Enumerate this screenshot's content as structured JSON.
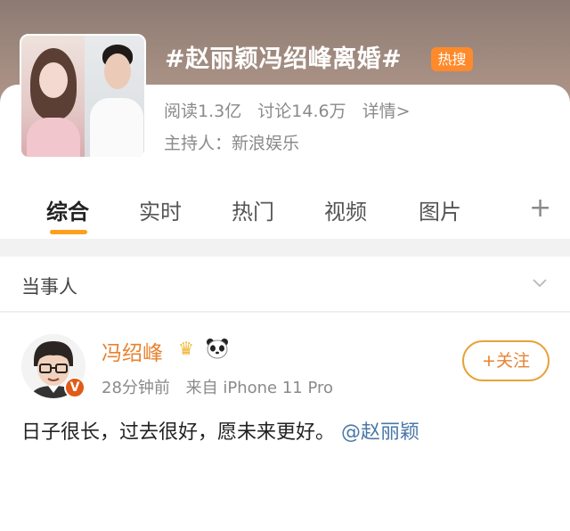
{
  "topic": {
    "title": "#赵丽颖冯绍峰离婚#",
    "badge": "热搜",
    "reads": "阅读1.3亿",
    "discussions": "讨论14.6万",
    "details": "详情>",
    "host": "主持人：新浪娱乐"
  },
  "tabs": [
    {
      "label": "综合"
    },
    {
      "label": "实时"
    },
    {
      "label": "热门"
    },
    {
      "label": "视频"
    },
    {
      "label": "图片"
    }
  ],
  "tab_more": "+",
  "section": {
    "title": "当事人"
  },
  "post": {
    "username": "冯绍峰",
    "time": "28分钟前",
    "source": "来自 iPhone 11 Pro",
    "follow_label": "+关注",
    "text": "日子很长，过去很好，愿未来更好。",
    "mention": "@赵丽颖"
  },
  "colors": {
    "accent": "#ff9f1c",
    "username": "#e8822f",
    "hot_badge": "#ff8a2b",
    "mention": "#4a78a8"
  }
}
